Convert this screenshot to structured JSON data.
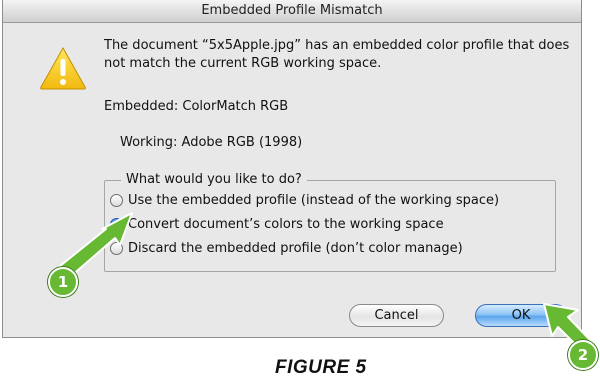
{
  "dialog": {
    "title": "Embedded Profile Mismatch",
    "message": "The document “5x5Apple.jpg” has an embedded color profile that does not match the current RGB working space.",
    "embedded_label": "Embedded:",
    "embedded_value": "ColorMatch RGB",
    "working_label": "Working:",
    "working_value": "Adobe RGB (1998)",
    "group_label": "What would you like to do?",
    "options": [
      {
        "label": "Use the embedded profile (instead of the working space)",
        "selected": false
      },
      {
        "label": "Convert document’s colors to the working space",
        "selected": true
      },
      {
        "label": "Discard the embedded profile (don’t color manage)",
        "selected": false
      }
    ],
    "cancel_label": "Cancel",
    "ok_label": "OK",
    "icon": "warning-icon"
  },
  "callouts": [
    {
      "number": "1",
      "color": "#67b832"
    },
    {
      "number": "2",
      "color": "#67b832"
    }
  ],
  "caption": "FIGURE 5"
}
